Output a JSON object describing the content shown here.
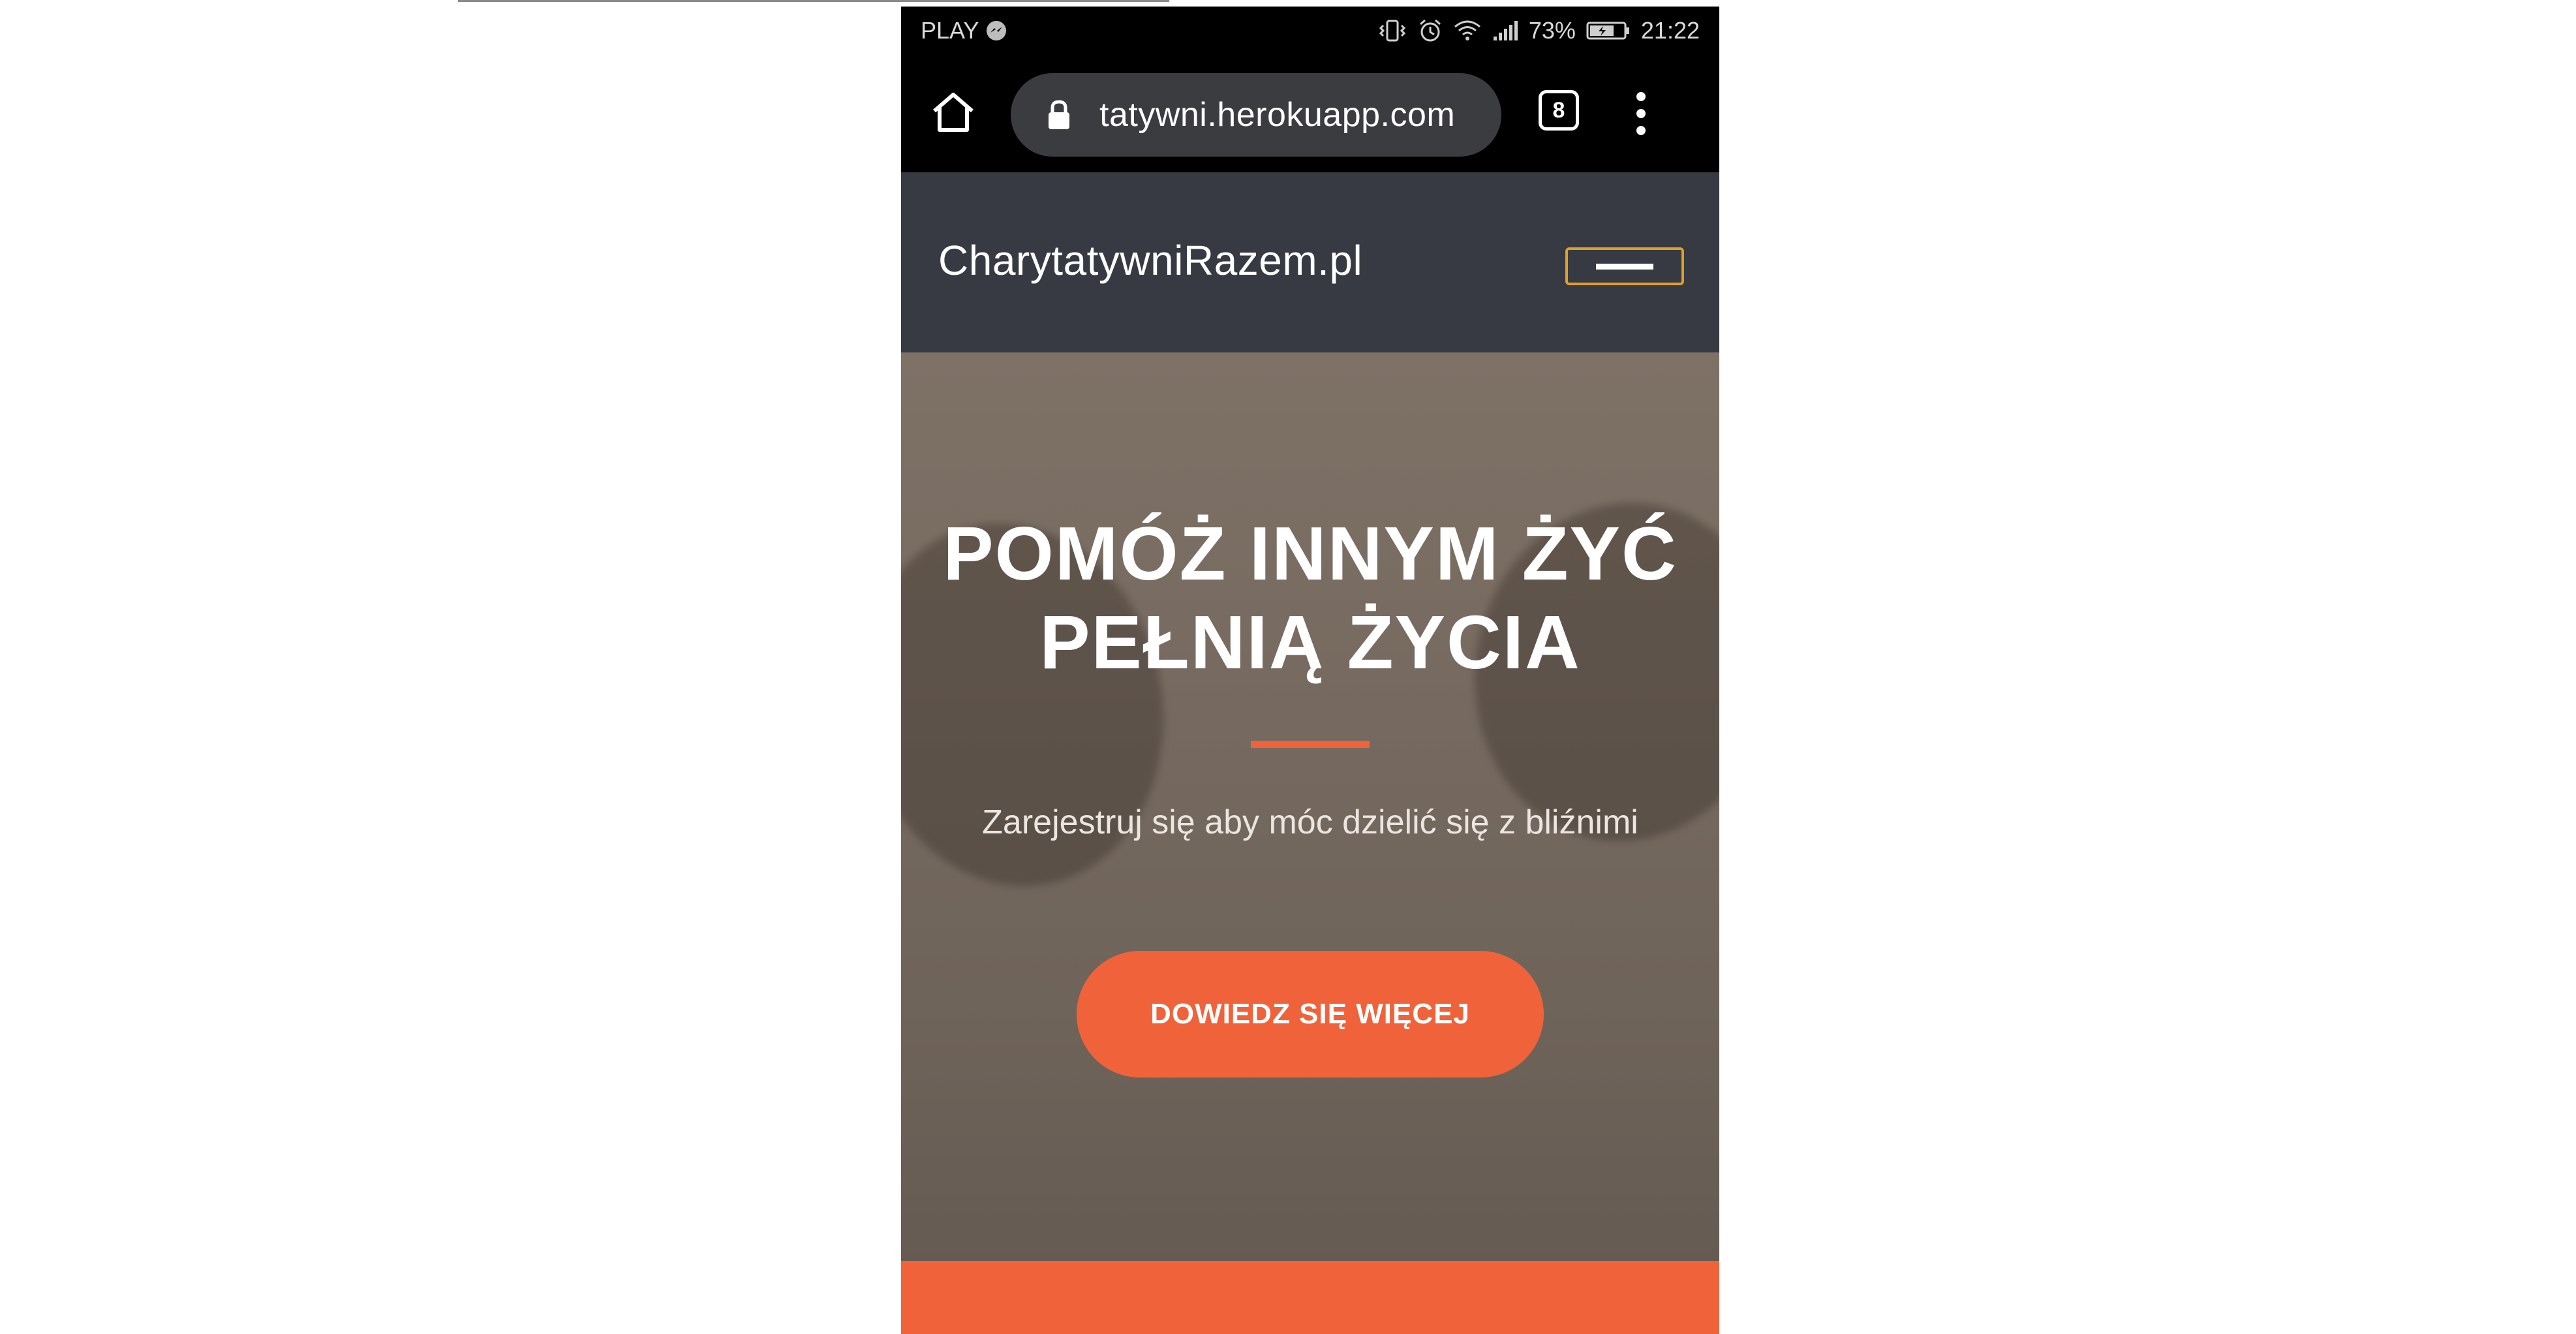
{
  "status_bar": {
    "carrier": "PLAY",
    "battery": "73%",
    "time": "21:22",
    "icons": [
      "messenger-icon",
      "vibrate-icon",
      "alarm-icon",
      "wifi-icon",
      "signal-icon",
      "battery-icon"
    ]
  },
  "browser": {
    "url": "tatywni.herokuapp.com",
    "tab_count": "8",
    "icons": [
      "home-icon",
      "lock-icon",
      "tabs-icon",
      "more-vert-icon"
    ]
  },
  "site": {
    "brand": "CharytatywniRazem.pl",
    "hero": {
      "title_line1": "POMÓŻ INNYM ŻYĆ",
      "title_line2": "PEŁNIĄ ŻYCIA",
      "subtitle": "Zarejestruj się aby móc dzielić się z bliźnimi",
      "cta": "DOWIEDZ SIĘ WIĘCEJ"
    }
  },
  "colors": {
    "accent": "#f0633a",
    "navbar": "#373a42",
    "toggler_border": "#e0a020",
    "browser_chrome": "#000000",
    "url_pill": "#3a3c40"
  }
}
